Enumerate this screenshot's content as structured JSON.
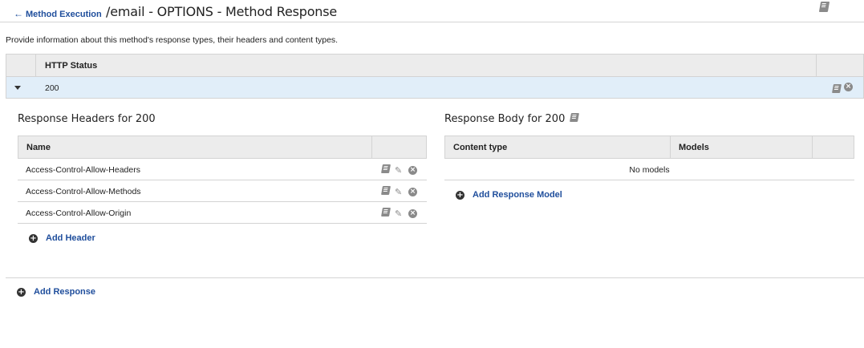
{
  "header": {
    "back_arrow": "←",
    "back_label": "Method Execution",
    "title": "/email - OPTIONS - Method Response"
  },
  "description": "Provide information about this method's response types, their headers and content types.",
  "status_table": {
    "column_header": "HTTP Status",
    "rows": [
      {
        "code": "200"
      }
    ]
  },
  "response_headers": {
    "title": "Response Headers for 200",
    "column_header": "Name",
    "rows": [
      {
        "name": "Access-Control-Allow-Headers"
      },
      {
        "name": "Access-Control-Allow-Methods"
      },
      {
        "name": "Access-Control-Allow-Origin"
      }
    ],
    "add_label": "Add Header"
  },
  "response_body": {
    "title": "Response Body for 200",
    "column_content_type": "Content type",
    "column_models": "Models",
    "empty_text": "No models",
    "add_label": "Add Response Model"
  },
  "add_response_label": "Add Response",
  "icons": {
    "plus": "+",
    "close": "×",
    "pencil": "✎"
  },
  "colors": {
    "link": "#1f4e9c",
    "selected_row": "#e1eef9",
    "header_bg": "#ececec",
    "icon_gray": "#8a8a8a"
  }
}
